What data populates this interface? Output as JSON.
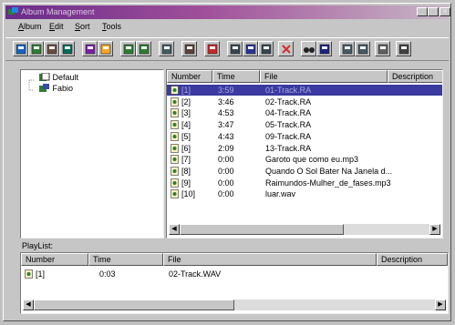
{
  "window": {
    "title": "Album Management",
    "controls": {
      "minimize": "_",
      "maximize": "□",
      "close": "×"
    }
  },
  "menu": [
    {
      "label": "Album",
      "underline": "A",
      "rest": "lbum"
    },
    {
      "label": "Edit",
      "underline": "E",
      "rest": "dit"
    },
    {
      "label": "Sort",
      "underline": "S",
      "rest": "ort"
    },
    {
      "label": "Tools",
      "underline": "T",
      "rest": "ools"
    }
  ],
  "toolbar": {
    "buttons": [
      "new-icon",
      "new-album-icon",
      "open-folder-icon",
      "save-icon",
      "cd-icon",
      "folder-icon",
      "cd-add-icon",
      "cd-remove-icon",
      "properties-icon",
      "gear-icon",
      "info-icon",
      "cut-icon",
      "copy-icon",
      "paste-icon",
      "delete-icon",
      "find-icon",
      "sort-icon",
      "view-large-icon",
      "view-small-icon",
      "exit-icon",
      "help-icon"
    ]
  },
  "tree": {
    "nodes": [
      {
        "label": "Default"
      },
      {
        "label": "Fabio"
      }
    ]
  },
  "tracks": {
    "columns": [
      "Number",
      "Time",
      "File",
      "Description"
    ],
    "rows": [
      {
        "number": "[1]",
        "time": "3:59",
        "file": "01-Track.RA",
        "selected": true
      },
      {
        "number": "[2]",
        "time": "3:46",
        "file": "02-Track.RA"
      },
      {
        "number": "[3]",
        "time": "4:53",
        "file": "04-Track.RA"
      },
      {
        "number": "[4]",
        "time": "3:47",
        "file": "05-Track.RA"
      },
      {
        "number": "[5]",
        "time": "4:43",
        "file": "09-Track.RA"
      },
      {
        "number": "[6]",
        "time": "2:09",
        "file": "13-Track.RA"
      },
      {
        "number": "[7]",
        "time": "0:00",
        "file": "Garoto que como eu.mp3"
      },
      {
        "number": "[8]",
        "time": "0:00",
        "file": "Quando O Sol Bater Na Janela d..."
      },
      {
        "number": "[9]",
        "time": "0:00",
        "file": "Raimundos-Mulher_de_fases.mp3"
      },
      {
        "number": "[10]",
        "time": "0:00",
        "file": "luar.wav"
      }
    ]
  },
  "playlist": {
    "label": "PlayList:",
    "columns": [
      "Number",
      "Time",
      "File",
      "Description"
    ],
    "rows": [
      {
        "number": "[1]",
        "time": "0:03",
        "file": "02-Track.WAV"
      }
    ]
  },
  "colors": {
    "selection": "#3a3aa0",
    "titlebar": "#6a2b8a"
  }
}
